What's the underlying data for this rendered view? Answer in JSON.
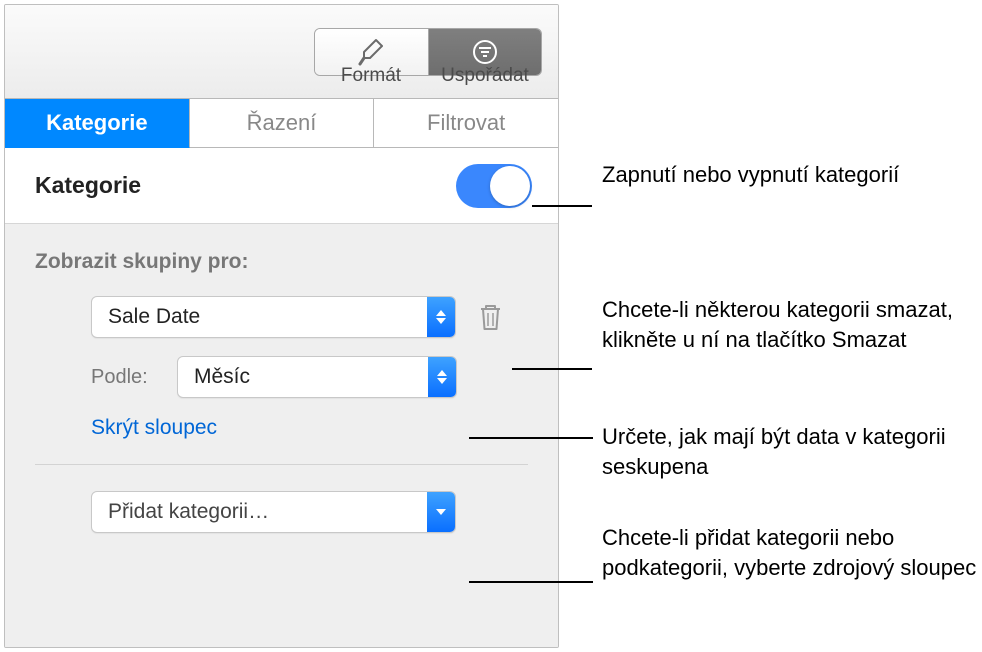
{
  "toolbar": {
    "format": {
      "label": "Formát"
    },
    "arrange": {
      "label": "Uspořádat"
    }
  },
  "tabs": {
    "categories": "Kategorie",
    "sort": "Řazení",
    "filter": "Filtrovat"
  },
  "section": {
    "title": "Kategorie"
  },
  "groups": {
    "label": "Zobrazit skupiny pro:",
    "field_value": "Sale Date",
    "by_label": "Podle:",
    "by_value": "Měsíc",
    "hide_column": "Skrýt sloupec",
    "add_category": "Přidat kategorii…"
  },
  "callouts": {
    "toggle": "Zapnutí nebo vypnutí kategorií",
    "delete": "Chcete-li některou kategorii smazat, klikněte u ní na tlačítko Smazat",
    "grouping": "Určete, jak mají být data v kategorii seskupena",
    "add": "Chcete-li přidat kategorii nebo podkategorii, vyberte zdrojový sloupec"
  }
}
